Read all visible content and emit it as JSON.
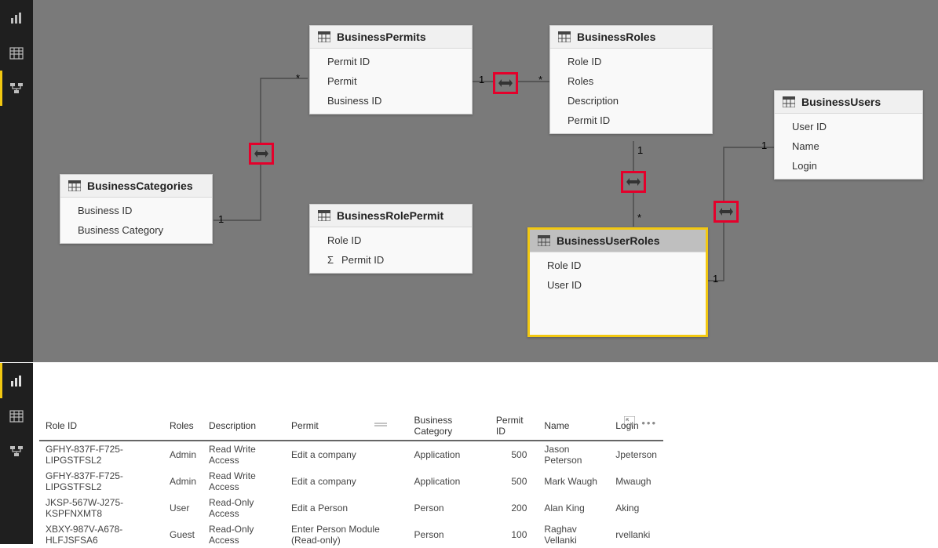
{
  "nav_top": {
    "items": [
      "report",
      "data",
      "model"
    ],
    "active": 2
  },
  "nav_bottom": {
    "items": [
      "report",
      "data",
      "model"
    ],
    "active": 0
  },
  "tables": {
    "BusinessPermits": {
      "title": "BusinessPermits",
      "fields": [
        "Permit ID",
        "Permit",
        "Business ID"
      ]
    },
    "BusinessRoles": {
      "title": "BusinessRoles",
      "fields": [
        "Role ID",
        "Roles",
        "Description",
        "Permit ID"
      ]
    },
    "BusinessCategories": {
      "title": "BusinessCategories",
      "fields": [
        "Business ID",
        "Business Category"
      ]
    },
    "BusinessRolePermit": {
      "title": "BusinessRolePermit",
      "fields": [
        "Role ID",
        "Permit ID"
      ]
    },
    "BusinessUserRoles": {
      "title": "BusinessUserRoles",
      "fields": [
        "Role ID",
        "User ID"
      ]
    },
    "BusinessUsers": {
      "title": "BusinessUsers",
      "fields": [
        "User ID",
        "Name",
        "Login"
      ]
    }
  },
  "cardinality": {
    "one": "1",
    "many": "*"
  },
  "sigma": "Σ",
  "grid": {
    "headers": [
      "Role ID",
      "Roles",
      "Description",
      "Permit",
      "Business Category",
      "Permit ID",
      "Name",
      "Login"
    ],
    "rows": [
      [
        "GFHY-837F-F725-LIPGSTFSL2",
        "Admin",
        "Read Write Access",
        "Edit a company",
        "Application",
        "500",
        "Jason Peterson",
        "Jpeterson"
      ],
      [
        "GFHY-837F-F725-LIPGSTFSL2",
        "Admin",
        "Read Write Access",
        "Edit a company",
        "Application",
        "500",
        "Mark Waugh",
        "Mwaugh"
      ],
      [
        "JKSP-567W-J275-KSPFNXMT8",
        "User",
        "Read-Only Access",
        "Edit a Person",
        "Person",
        "200",
        "Alan King",
        "Aking"
      ],
      [
        "XBXY-987V-A678-HLFJSFSA6",
        "Guest",
        "Read-Only Access",
        "Enter Person Module (Read-only)",
        "Person",
        "100",
        "Raghav Vellanki",
        "rvellanki"
      ]
    ]
  }
}
